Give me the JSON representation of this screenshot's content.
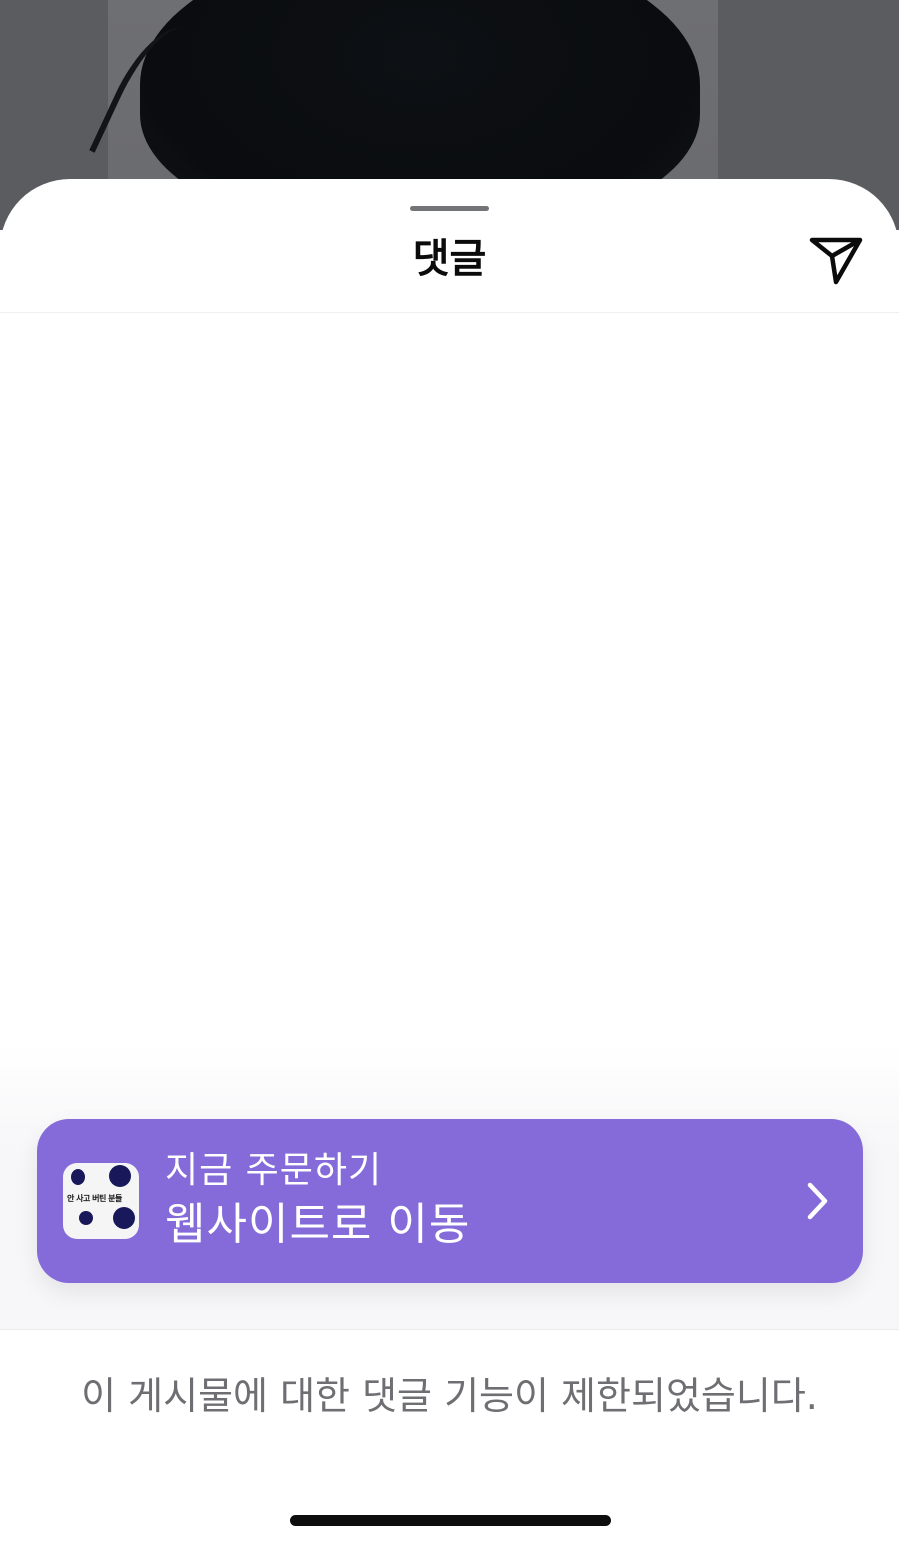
{
  "sheet": {
    "title": "댓글",
    "share_icon": "paper-plane-icon"
  },
  "cta": {
    "thumbnail_text": "안 사고 버틴 분들",
    "line1": "지금 주문하기",
    "line2": "웹사이트로 이동",
    "chevron_icon": "chevron-right-icon",
    "color": "#846bd9"
  },
  "footer": {
    "restricted_message": "이 게시물에 대한 댓글 기능이 제한되었습니다."
  }
}
